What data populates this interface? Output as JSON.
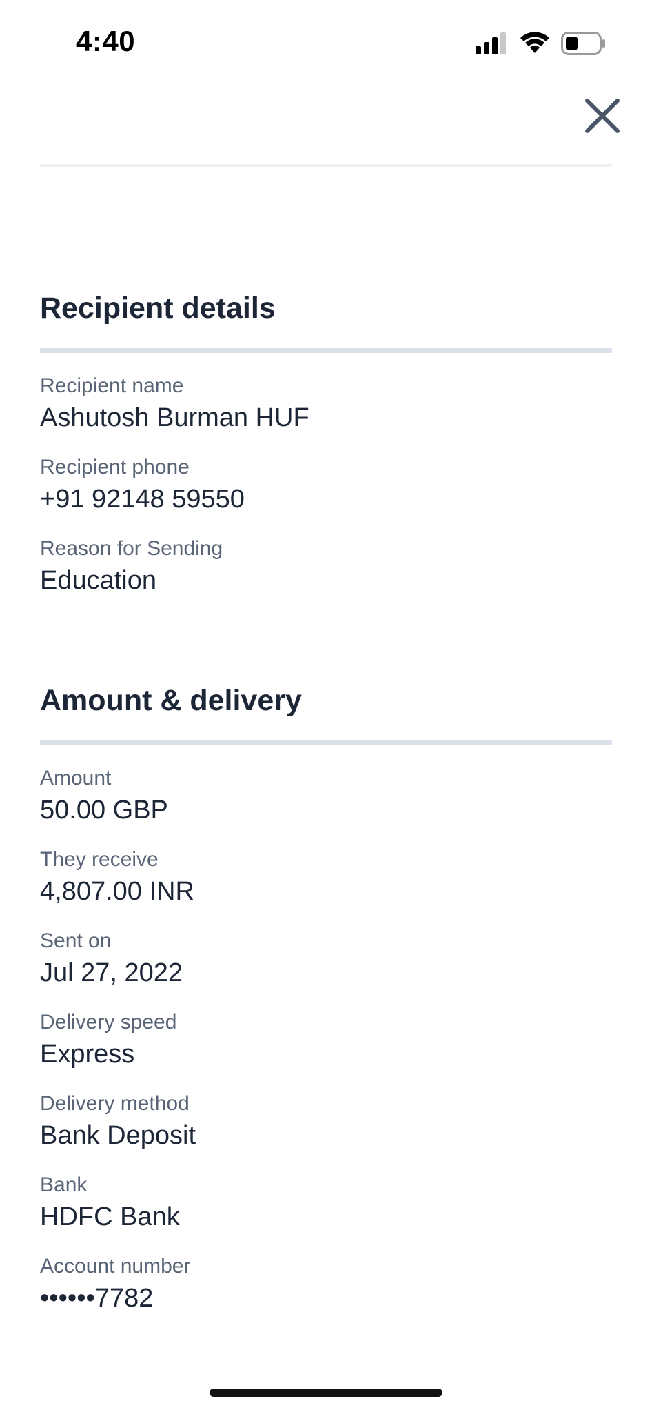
{
  "status_bar": {
    "time": "4:40"
  },
  "header": {
    "close_icon": "close-icon"
  },
  "recipient_section": {
    "title": "Recipient details",
    "fields": [
      {
        "label": "Recipient name",
        "value": "Ashutosh Burman HUF"
      },
      {
        "label": "Recipient phone",
        "value": "+91 92148 59550"
      },
      {
        "label": "Reason for Sending",
        "value": "Education"
      }
    ]
  },
  "amount_section": {
    "title": "Amount & delivery",
    "fields": [
      {
        "label": "Amount",
        "value": "50.00 GBP"
      },
      {
        "label": "They receive",
        "value": "4,807.00 INR"
      },
      {
        "label": "Sent on",
        "value": "Jul 27, 2022"
      },
      {
        "label": "Delivery speed",
        "value": "Express"
      },
      {
        "label": "Delivery method",
        "value": "Bank Deposit"
      },
      {
        "label": "Bank",
        "value": "HDFC Bank"
      },
      {
        "label": "Account number",
        "value": "••••••7782"
      }
    ]
  },
  "colors": {
    "text_primary": "#1c2637",
    "text_secondary": "#596577",
    "rule": "#dbe0e8",
    "close_icon": "#4a5566"
  }
}
